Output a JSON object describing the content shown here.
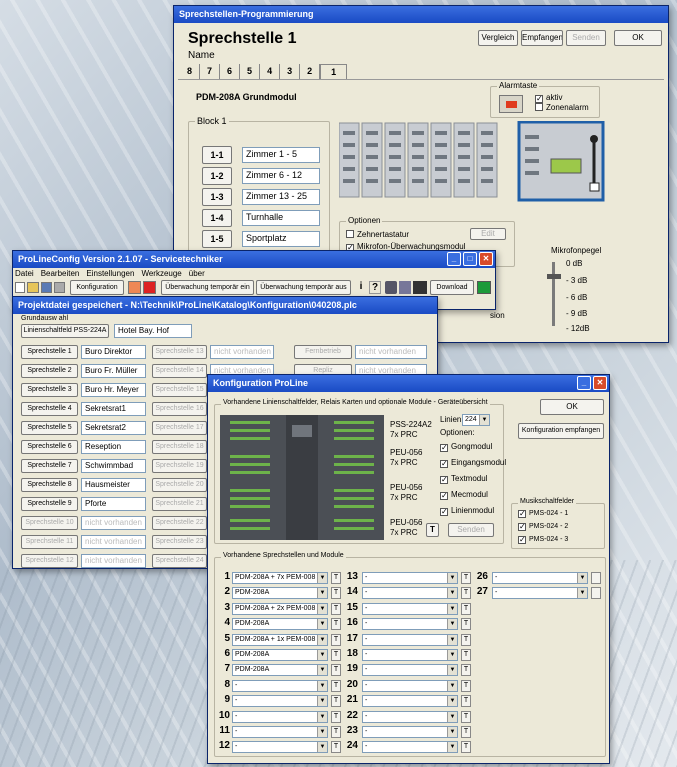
{
  "w1": {
    "title": "Sprechstellen-Programmierung",
    "heading": "Sprechstelle 1",
    "name_label": "Name",
    "tabs": [
      "8",
      "7",
      "6",
      "5",
      "4",
      "3",
      "2",
      "1"
    ],
    "btn_vergleich": "Vergleich",
    "btn_empfangen": "Empfangen",
    "btn_senden": "Senden",
    "btn_ok": "OK",
    "module_title": "PDM-208A Grundmodul",
    "alarm_title": "Alarmtaste",
    "alarm_aktiv": "aktiv",
    "alarm_zonen": "Zonenalarm",
    "block_title": "Block 1",
    "blocks": [
      {
        "key": "1-1",
        "label": "Zimmer 1 - 5"
      },
      {
        "key": "1-2",
        "label": "Zimmer 6 - 12"
      },
      {
        "key": "1-3",
        "label": "Zimmer 13 - 25"
      },
      {
        "key": "1-4",
        "label": "Turnhalle"
      },
      {
        "key": "1-5",
        "label": "Sportplatz"
      }
    ],
    "options_title": "Optionen",
    "opt_zehner": "Zehnertastatur",
    "opt_mikro": "Mikrofon-Überwachungsmodul",
    "btn_edit": "Edit",
    "pegel_title": "Mikrofonpegel",
    "pegel": [
      "0 dB",
      "- 3 dB",
      "- 6 dB",
      "- 9 dB",
      "- 12dB"
    ],
    "frag_sion": "sion"
  },
  "w2": {
    "title": "ProLineConfig Version 2.1.07 - Servicetechniker",
    "menu": [
      "Datei",
      "Bearbeiten",
      "Einstellungen",
      "Werkzeuge",
      "über"
    ],
    "tb_konfiguration": "Konfiguration",
    "tb_uber_ein": "Überwachung temporär ein",
    "tb_uber_aus": "Überwachung temporär aus",
    "tb_download": "Download"
  },
  "w3": {
    "title": "Projektdatei gespeichert - N:\\Technik\\ProLine\\Katalog\\Konfiguration\\040208.plc",
    "group": "Grundausw ahl",
    "ls_button": "Linienschaltfeld PSS-224A",
    "ls_name": "Hotel Bay. Hof",
    "col1": [
      {
        "b": "Sprechstelle 1",
        "v": "Buro Direktor"
      },
      {
        "b": "Sprechstelle 2",
        "v": "Buro Fr. Müller"
      },
      {
        "b": "Sprechstelle 3",
        "v": "Buro Hr. Meyer"
      },
      {
        "b": "Sprechstelle 4",
        "v": "Sekretsrat1"
      },
      {
        "b": "Sprechstelle 5",
        "v": "Sekretsrat2"
      },
      {
        "b": "Sprechstelle 6",
        "v": "Reseption"
      },
      {
        "b": "Sprechstelle 7",
        "v": "Schwimmbad"
      },
      {
        "b": "Sprechstelle 8",
        "v": "Hausmeister"
      },
      {
        "b": "Sprechstelle 9",
        "v": "Pforte"
      },
      {
        "b": "Sprechstelle 10",
        "v": "nicht vorhanden"
      },
      {
        "b": "Sprechstelle 11",
        "v": "nicht vorhanden"
      },
      {
        "b": "Sprechstelle 12",
        "v": "nicht vorhanden"
      }
    ],
    "col2": [
      "Sprechstelle 13",
      "Sprechstelle 14",
      "Sprechstelle 15",
      "Sprechstelle 16",
      "Sprechstelle 17",
      "Sprechstelle 18",
      "Sprechstelle 19",
      "Sprechstelle 20",
      "Sprechstelle 21",
      "Sprechstelle 22",
      "Sprechstelle 23",
      "Sprechstelle 24"
    ],
    "nv": "nicht vorhanden",
    "col3": [
      "Fernbetrieb",
      "Repliz"
    ]
  },
  "w4": {
    "title": "Konfiguration ProLine",
    "group_top": "Vorhandene Linienschaltfelder, Relais Karten und optionale Module - Geräteübersicht",
    "btn_ok": "OK",
    "btn_konf": "Konfiguration empfangen",
    "pss": "PSS-224A2",
    "prc": "7x PRC",
    "linien_label": "Linien:",
    "linien_val": "224",
    "optionen": "Optionen:",
    "opts": [
      "Gongmodul",
      "Eingangsmodul",
      "Textmodul",
      "Mecmodul",
      "Linienmodul"
    ],
    "peu": "PEU-056",
    "btn_t": "T",
    "btn_senden": "Senden",
    "musik_title": "Musikschaltfelder",
    "musik": [
      "PMS-024 - 1",
      "PMS-024 - 2",
      "PMS-024 - 3"
    ],
    "group_bottom": "Vorhandene Sprechstellen und Module",
    "rows": [
      {
        "n": "1",
        "v": "PDM-208A + 7x PEM-008"
      },
      {
        "n": "2",
        "v": "PDM-208A"
      },
      {
        "n": "3",
        "v": "PDM-208A + 2x PEM-008"
      },
      {
        "n": "4",
        "v": "PDM-208A"
      },
      {
        "n": "5",
        "v": "PDM-208A + 1x PEM-008"
      },
      {
        "n": "6",
        "v": "PDM-208A"
      },
      {
        "n": "7",
        "v": "PDM-208A"
      },
      {
        "n": "8",
        "v": "-"
      },
      {
        "n": "9",
        "v": "-"
      },
      {
        "n": "10",
        "v": "-"
      },
      {
        "n": "11",
        "v": "-"
      },
      {
        "n": "12",
        "v": "-"
      }
    ],
    "rows2": [
      "13",
      "14",
      "15",
      "16",
      "17",
      "18",
      "19",
      "20",
      "21",
      "22",
      "23",
      "24"
    ],
    "rows3": [
      "26",
      "27"
    ],
    "dash": "-"
  }
}
